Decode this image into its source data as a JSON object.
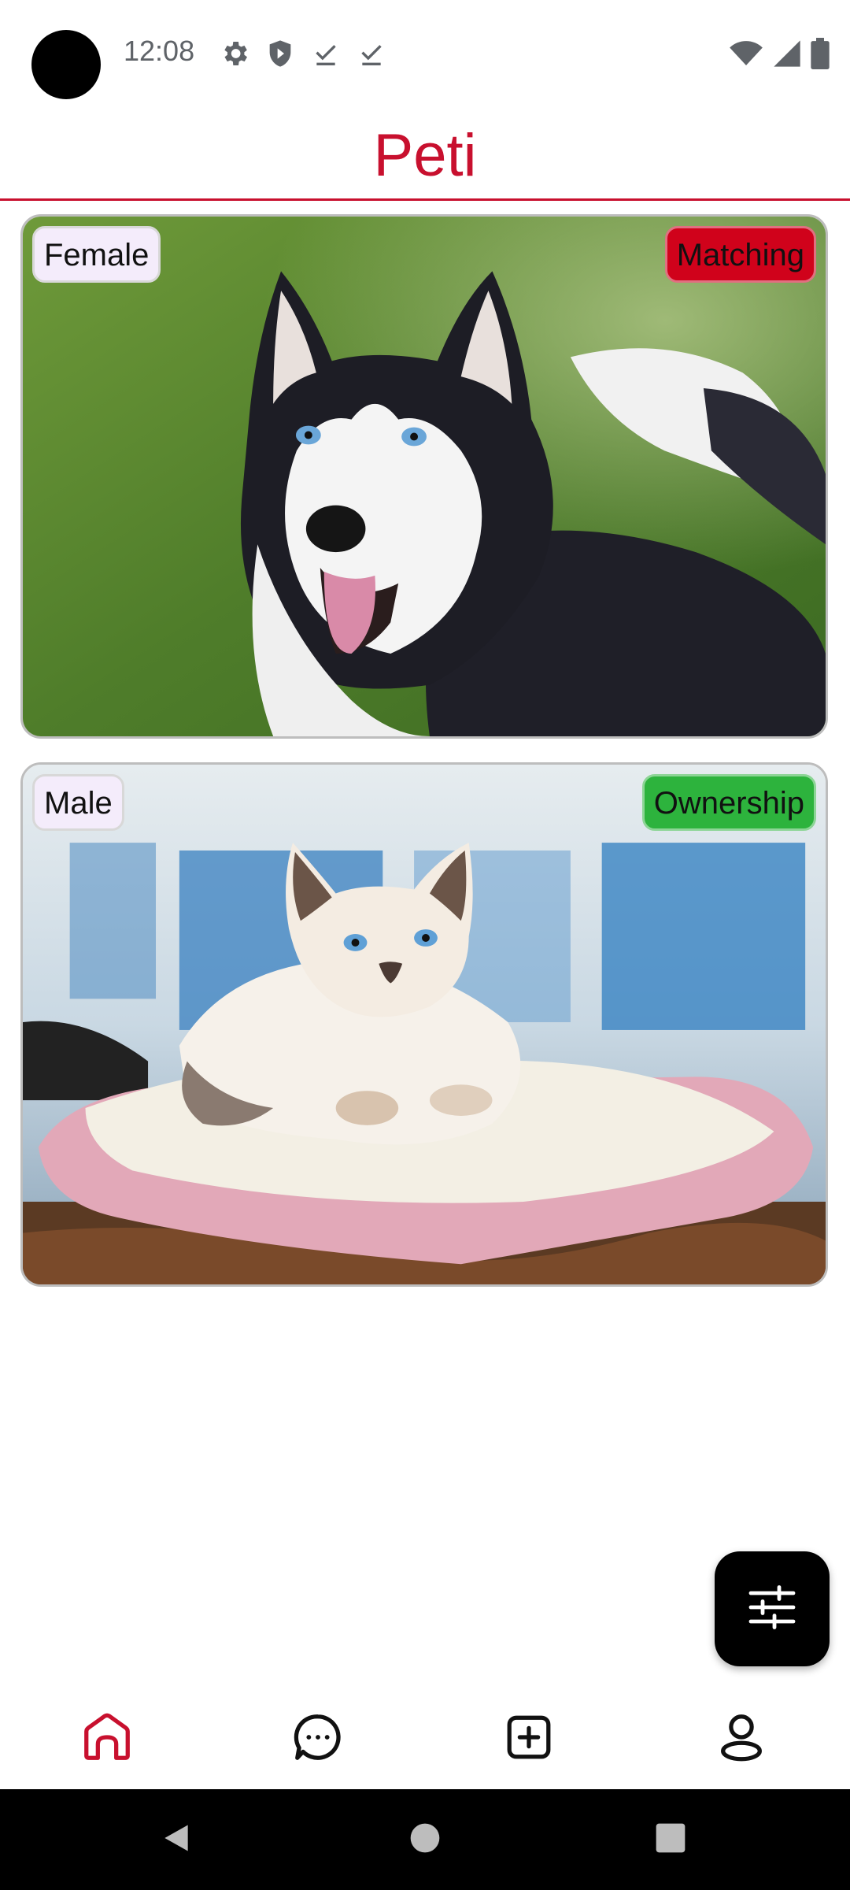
{
  "status_bar": {
    "time": "12:08",
    "left_icons": [
      "gear-icon",
      "shield-icon",
      "download-done-icon",
      "download-done-icon"
    ],
    "right_icons": [
      "wifi-icon",
      "signal-icon",
      "battery-icon"
    ]
  },
  "app": {
    "title": "Peti",
    "accent_color": "#c8102e"
  },
  "cards": [
    {
      "gender": "Female",
      "tag": "Matching",
      "tag_color": "#d0021b",
      "image": "husky-dog-photo"
    },
    {
      "gender": "Male",
      "tag": "Ownership",
      "tag_color": "#2db33d",
      "image": "siamese-kitten-photo"
    }
  ],
  "fab": {
    "icon": "filter-sliders-icon"
  },
  "bottom_nav": {
    "items": [
      {
        "name": "home",
        "icon": "home-icon",
        "active": true
      },
      {
        "name": "chat",
        "icon": "chat-bubble-icon",
        "active": false
      },
      {
        "name": "add",
        "icon": "add-square-icon",
        "active": false
      },
      {
        "name": "profile",
        "icon": "profile-icon",
        "active": false
      }
    ]
  },
  "system_nav": {
    "buttons": [
      "back-icon",
      "home-circle-icon",
      "recents-icon"
    ]
  }
}
